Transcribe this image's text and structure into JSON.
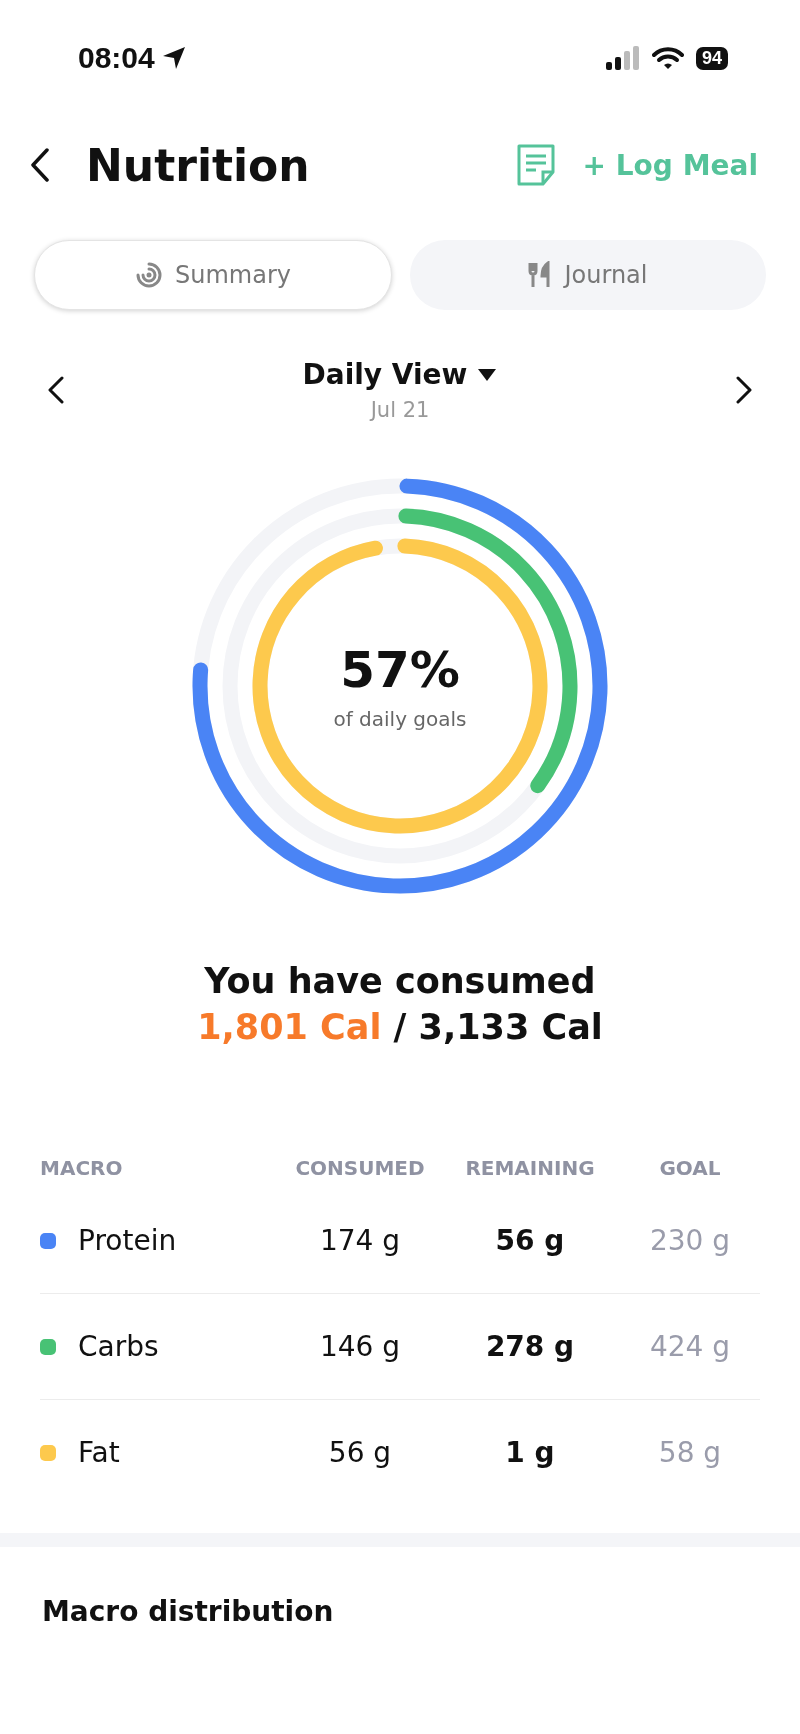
{
  "status_bar": {
    "time": "08:04",
    "battery": "94"
  },
  "header": {
    "title": "Nutrition",
    "action": "Log Meal",
    "action_symbol": "+"
  },
  "tabs": [
    {
      "label": "Summary",
      "kind": "summary",
      "selected": true
    },
    {
      "label": "Journal",
      "kind": "journal",
      "selected": false
    }
  ],
  "date_nav": {
    "title": "Daily View",
    "date": "Jul 21"
  },
  "ring": {
    "percent": "57%",
    "caption": "of daily goals"
  },
  "total": {
    "heading": "You have consumed",
    "consumed": "1,801 Cal",
    "separator": "/",
    "goal": "3,133 Cal"
  },
  "table": {
    "columns": [
      "MACRO",
      "CONSUMED",
      "REMAINING",
      "GOAL"
    ],
    "rows": [
      {
        "name": "Protein",
        "color": "#4a84f5",
        "consumed": "174 g",
        "remaining": "56 g",
        "goal": "230 g",
        "level": 0.757
      },
      {
        "name": "Carbs",
        "color": "#48c275",
        "consumed": "146 g",
        "remaining": "278 g",
        "goal": "424 g",
        "level": 0.344
      },
      {
        "name": "Fat",
        "color": "#fdc94d",
        "consumed": "56 g",
        "remaining": "1 g",
        "goal": "58 g",
        "level": 0.966
      }
    ]
  },
  "section": {
    "title": "Macro distribution"
  }
}
